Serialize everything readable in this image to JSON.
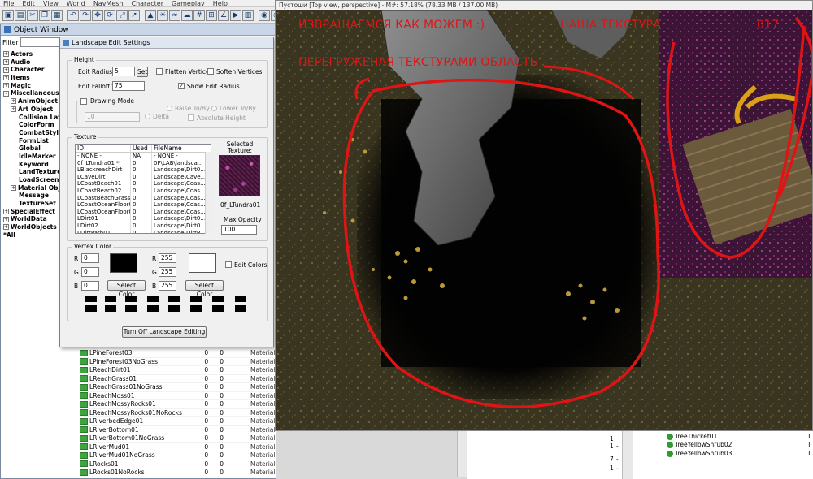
{
  "menu": [
    "File",
    "Edit",
    "View",
    "World",
    "NavMesh",
    "Character",
    "Gameplay",
    "Help"
  ],
  "toolbar_icons": [
    "open-icon",
    "save-icon",
    "cut-icon",
    "copy-icon",
    "paste-icon",
    "undo-icon",
    "redo-icon",
    "move-icon",
    "rotate-icon",
    "scale-icon",
    "select-icon",
    "terrain-icon",
    "light-icon",
    "water-icon",
    "sky-icon",
    "grid-icon",
    "snap-icon",
    "angle-icon",
    "anim-icon",
    "chart-icon",
    "render-icon",
    "camera-icon",
    "navmesh-icon",
    "cloud-icon",
    "layers-icon",
    "marker-icon",
    "edit-icon",
    "check-icon",
    "zoom-icon"
  ],
  "object_window": {
    "title": "Object Window",
    "filter_label": "Filter",
    "filter_value": "",
    "tree": [
      {
        "label": "Actors",
        "level": 0,
        "expand": "+"
      },
      {
        "label": "Audio",
        "level": 0,
        "expand": "+"
      },
      {
        "label": "Character",
        "level": 0,
        "expand": "+"
      },
      {
        "label": "Items",
        "level": 0,
        "expand": "+"
      },
      {
        "label": "Magic",
        "level": 0,
        "expand": "+"
      },
      {
        "label": "Miscellaneous",
        "level": 0,
        "expand": "-"
      },
      {
        "label": "AnimObject",
        "level": 1,
        "expand": "+"
      },
      {
        "label": "Art Object",
        "level": 1,
        "expand": "+"
      },
      {
        "label": "Collision Layer",
        "level": 2,
        "expand": ""
      },
      {
        "label": "ColorForm",
        "level": 2,
        "expand": ""
      },
      {
        "label": "CombatStyle",
        "level": 2,
        "expand": ""
      },
      {
        "label": "FormList",
        "level": 2,
        "expand": ""
      },
      {
        "label": "Global",
        "level": 2,
        "expand": ""
      },
      {
        "label": "IdleMarker",
        "level": 2,
        "expand": ""
      },
      {
        "label": "Keyword",
        "level": 2,
        "expand": ""
      },
      {
        "label": "LandTexture",
        "level": 2,
        "expand": ""
      },
      {
        "label": "LoadScreen",
        "level": 2,
        "expand": ""
      },
      {
        "label": "Material Object",
        "level": 1,
        "expand": "+"
      },
      {
        "label": "Message",
        "level": 2,
        "expand": ""
      },
      {
        "label": "TextureSet",
        "level": 2,
        "expand": ""
      },
      {
        "label": "SpecialEffect",
        "level": 0,
        "expand": "+"
      },
      {
        "label": "WorldData",
        "level": 0,
        "expand": "+"
      },
      {
        "label": "WorldObjects",
        "level": 0,
        "expand": "+"
      },
      {
        "label": "*All",
        "level": 0,
        "expand": ""
      }
    ],
    "list_rows": [
      {
        "name": "LPineForest03",
        "used": "0",
        "count": "0",
        "file": "Material..."
      },
      {
        "name": "LPineForest03NoGrass",
        "used": "0",
        "count": "0",
        "file": "Material..."
      },
      {
        "name": "LReachDirt01",
        "used": "0",
        "count": "0",
        "file": "Material..."
      },
      {
        "name": "LReachGrass01",
        "used": "0",
        "count": "0",
        "file": "Material..."
      },
      {
        "name": "LReachGrass01NoGrass",
        "used": "0",
        "count": "0",
        "file": "Material..."
      },
      {
        "name": "LReachMoss01",
        "used": "0",
        "count": "0",
        "file": "Material..."
      },
      {
        "name": "LReachMossyRocks01",
        "used": "0",
        "count": "0",
        "file": "Material..."
      },
      {
        "name": "LReachMossyRocks01NoRocks",
        "used": "0",
        "count": "0",
        "file": "Material..."
      },
      {
        "name": "LRiverbedEdge01",
        "used": "0",
        "count": "0",
        "file": "Material..."
      },
      {
        "name": "LRiverBottom01",
        "used": "0",
        "count": "0",
        "file": "Material..."
      },
      {
        "name": "LRiverBottom01NoGrass",
        "used": "0",
        "count": "0",
        "file": "Material..."
      },
      {
        "name": "LRiverMud01",
        "used": "0",
        "count": "0",
        "file": "Material..."
      },
      {
        "name": "LRiverMud01NoGrass",
        "used": "0",
        "count": "0",
        "file": "Material..."
      },
      {
        "name": "LRocks01",
        "used": "0",
        "count": "0",
        "file": "Material..."
      },
      {
        "name": "LRocks01NoRocks",
        "used": "0",
        "count": "0",
        "file": "Material..."
      }
    ]
  },
  "dialog": {
    "title": "Landscape Edit Settings",
    "height_group": "Height",
    "edit_radius_label": "Edit Radius:",
    "edit_radius_value": "5",
    "set_button": "Set",
    "flatten_label": "Flatten Vertices",
    "soften_label": "Soften Vertices",
    "falloff_label": "Edit Falloff %:",
    "falloff_value": "75",
    "show_radius_label": "Show Edit Radius",
    "show_radius_checked": "✓",
    "drawing_mode_label": "Drawing Mode",
    "drawing_value": "10",
    "raise_label": "Raise To/By",
    "lower_label": "Lower To/By",
    "delta_label": "Delta",
    "absolute_label": "Absolute Height",
    "texture_group": "Texture",
    "tex_headers": {
      "id": "ID",
      "used": "Used",
      "file": "FileName"
    },
    "tex_rows": [
      {
        "id": "- NONE -",
        "used": "NA",
        "file": "- NONE -"
      },
      {
        "id": "0f_LTundra01 *",
        "used": "0",
        "file": "0F\\LAB\\landsca..."
      },
      {
        "id": "LBlackreachDirt",
        "used": "0",
        "file": "Landscape\\Dirt0..."
      },
      {
        "id": "LCaveDirt",
        "used": "0",
        "file": "Landscape\\Cave..."
      },
      {
        "id": "LCoastBeach01",
        "used": "0",
        "file": "Landscape\\Coas..."
      },
      {
        "id": "LCoastBeach02",
        "used": "0",
        "file": "Landscape\\Coas..."
      },
      {
        "id": "LCoastBeachGrass01",
        "used": "0",
        "file": "Landscape\\Coas..."
      },
      {
        "id": "LCoastOceanFloor01",
        "used": "0",
        "file": "Landscape\\Coas..."
      },
      {
        "id": "LCoastOceanFloor0...",
        "used": "0",
        "file": "Landscape\\Coas..."
      },
      {
        "id": "LDirt01",
        "used": "0",
        "file": "Landscape\\Dirt0..."
      },
      {
        "id": "LDirt02",
        "used": "0",
        "file": "Landscape\\Dirt0..."
      },
      {
        "id": "LDirtPath01",
        "used": "0",
        "file": "Landscape\\DirtP..."
      }
    ],
    "selected_texture_label": "Selected Texture:",
    "selected_texture_name": "0f_LTundra01",
    "max_opacity_label": "Max Opacity",
    "max_opacity_value": "100",
    "vertex_group": "Vertex Color",
    "r_label": "R",
    "g_label": "G",
    "b_label": "B",
    "left_r": "0",
    "left_g": "0",
    "left_b": "0",
    "right_r": "255",
    "right_g": "255",
    "right_b": "255",
    "select_color_left": "Select Color",
    "select_color_right": "Select Color",
    "edit_colors_label": "Edit Colors",
    "turn_off_button": "Turn Off Landscape Editing"
  },
  "viewport": {
    "title": "Пустоши [Top view, perspective] - M#: 57.18% (78.33 MB / 137.00 MB)",
    "overlay_1": "ИЗВРАЩАЕМСЯ КАК МОЖЕМ :)",
    "overlay_2": "НАША ТЕКСТУРА",
    "overlay_3": "017",
    "overlay_4": "ПЕРЕГРУЖЕНАЯ ТЕКСТУРАМИ ОБЛАСТЬ",
    "annotation_color": "#e01414"
  },
  "right_list": {
    "rows": [
      {
        "name": "TreeThicket01",
        "val": "T"
      },
      {
        "name": "TreeYellowShrub02",
        "val": "T"
      },
      {
        "name": "TreeYellowShrub03",
        "val": "T"
      }
    ],
    "mid_values": [
      "1",
      "1",
      "7",
      "1"
    ],
    "mid_dash": "-"
  }
}
